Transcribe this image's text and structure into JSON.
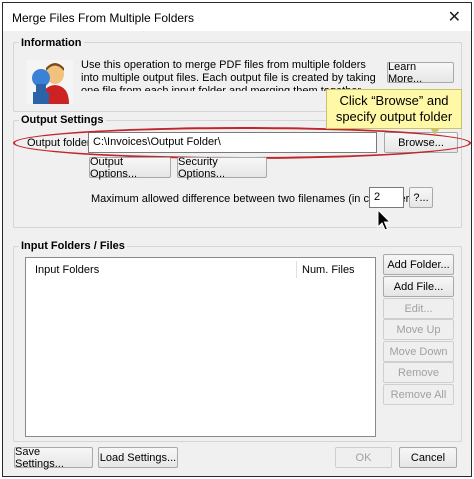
{
  "window": {
    "title": "Merge Files From Multiple Folders"
  },
  "information": {
    "title": "Information",
    "text": "Use this operation to merge PDF files from multiple folders into multiple output files. Each output file is created by taking one file from each input folder and merging them together. Files are merged based on filenames.",
    "learn_more_label": "Learn More..."
  },
  "callout": {
    "text": "Click “Browse” and specify output folder"
  },
  "output_settings": {
    "title": "Output Settings",
    "output_folder_label": "Output folder:",
    "output_folder_value": "C:\\Invoices\\Output Folder\\",
    "browse_label": "Browse...",
    "output_options_label": "Output Options...",
    "security_options_label": "Security Options...",
    "max_diff_label": "Maximum allowed difference between two filenames (in characters):",
    "max_diff_value": "2",
    "help_label": "?..."
  },
  "input_folders": {
    "title": "Input Folders / Files",
    "columns": [
      "Input Folders",
      "Num. Files"
    ],
    "add_folder_label": "Add Folder...",
    "add_file_label": "Add File...",
    "edit_label": "Edit...",
    "move_up_label": "Move Up",
    "move_down_label": "Move Down",
    "remove_label": "Remove",
    "remove_all_label": "Remove All"
  },
  "footer": {
    "save_settings_label": "Save Settings...",
    "load_settings_label": "Load Settings...",
    "ok_label": "OK",
    "cancel_label": "Cancel"
  },
  "colors": {
    "highlight_oval": "#c0272d",
    "callout_bg": "#fff8a6",
    "window_bg": "#f0f0f0"
  }
}
